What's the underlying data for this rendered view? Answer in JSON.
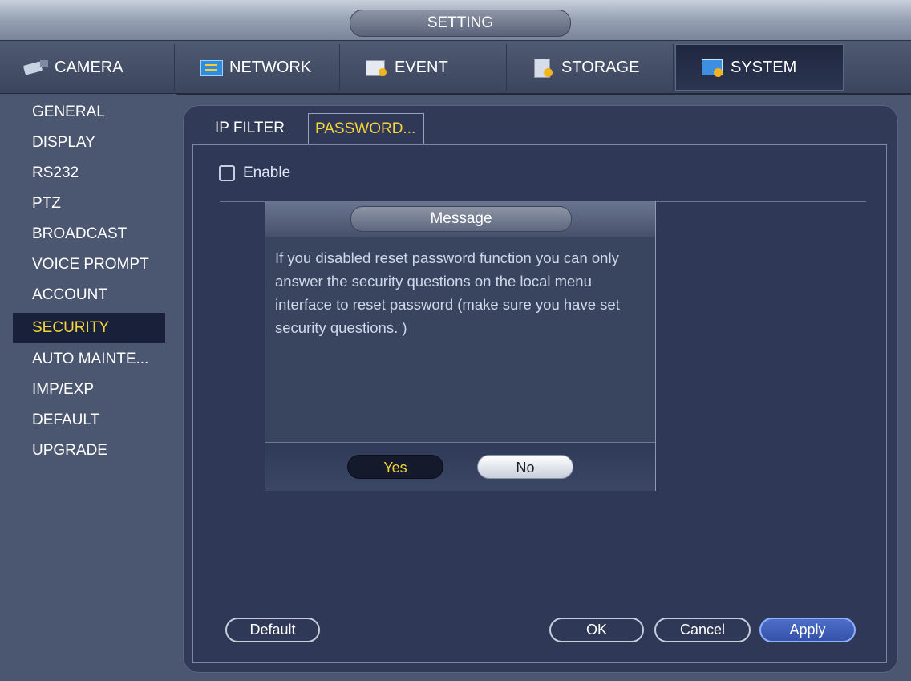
{
  "window": {
    "title": "SETTING"
  },
  "tabs": [
    {
      "label": "CAMERA",
      "icon": "camera-icon"
    },
    {
      "label": "NETWORK",
      "icon": "network-icon"
    },
    {
      "label": "EVENT",
      "icon": "event-icon"
    },
    {
      "label": "STORAGE",
      "icon": "storage-icon"
    },
    {
      "label": "SYSTEM",
      "icon": "system-icon",
      "active": true
    }
  ],
  "sidebar": {
    "items": [
      {
        "label": "GENERAL"
      },
      {
        "label": "DISPLAY"
      },
      {
        "label": "RS232"
      },
      {
        "label": "PTZ"
      },
      {
        "label": "BROADCAST"
      },
      {
        "label": "VOICE PROMPT"
      },
      {
        "label": "ACCOUNT"
      },
      {
        "label": "SECURITY",
        "active": true
      },
      {
        "label": "AUTO MAINTE..."
      },
      {
        "label": "IMP/EXP"
      },
      {
        "label": "DEFAULT"
      },
      {
        "label": "UPGRADE"
      }
    ]
  },
  "subtabs": [
    {
      "label": "IP FILTER"
    },
    {
      "label": "PASSWORD...",
      "active": true
    }
  ],
  "enable": {
    "label": "Enable",
    "checked": false
  },
  "buttons": {
    "default": "Default",
    "ok": "OK",
    "cancel": "Cancel",
    "apply": "Apply"
  },
  "dialog": {
    "title": "Message",
    "text": " If you disabled reset password function you can only answer the security questions on the local menu interface to reset password (make sure you have set security questions. )",
    "yes": "Yes",
    "no": "No"
  },
  "colors": {
    "accent_selected": "#f5d33a",
    "panel_bg": "#2f3856",
    "primary_button": "#3553a9"
  }
}
